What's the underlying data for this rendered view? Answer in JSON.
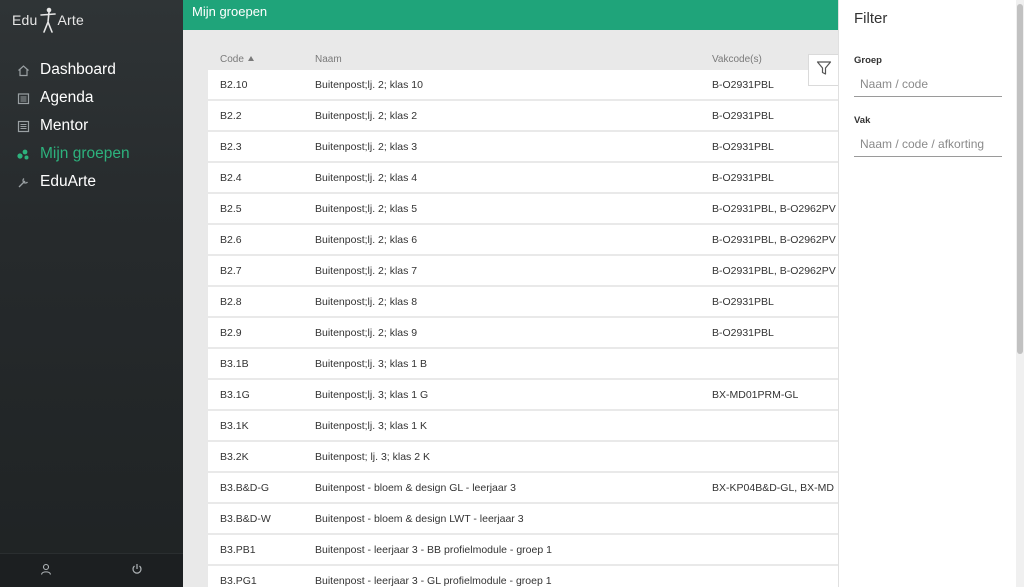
{
  "app": {
    "logo_left": "Edu",
    "logo_right": "Arte"
  },
  "sidebar": {
    "items": [
      {
        "label": "Dashboard",
        "icon": "home-icon"
      },
      {
        "label": "Agenda",
        "icon": "calendar-icon"
      },
      {
        "label": "Mentor",
        "icon": "list-icon"
      },
      {
        "label": "Mijn groepen",
        "icon": "groups-icon",
        "active": true
      },
      {
        "label": "EduArte",
        "icon": "tools-icon"
      }
    ],
    "bottom": [
      {
        "icon": "user-icon"
      },
      {
        "icon": "power-icon"
      }
    ]
  },
  "header": {
    "title": "Mijn groepen"
  },
  "table": {
    "columns": {
      "code": "Code",
      "naam": "Naam",
      "vakcodes": "Vakcode(s)"
    },
    "sort": {
      "column": "code",
      "direction": "ascending"
    },
    "rows": [
      {
        "code": "B2.10",
        "naam": "Buitenpost;lj. 2; klas 10",
        "vakcodes": "B-O2931PBL"
      },
      {
        "code": "B2.2",
        "naam": "Buitenpost;lj. 2; klas 2",
        "vakcodes": "B-O2931PBL"
      },
      {
        "code": "B2.3",
        "naam": "Buitenpost;lj. 2; klas 3",
        "vakcodes": "B-O2931PBL"
      },
      {
        "code": "B2.4",
        "naam": "Buitenpost;lj. 2; klas 4",
        "vakcodes": "B-O2931PBL"
      },
      {
        "code": "B2.5",
        "naam": "Buitenpost;lj. 2; klas 5",
        "vakcodes": "B-O2931PBL, B-O2962PV"
      },
      {
        "code": "B2.6",
        "naam": "Buitenpost;lj. 2; klas 6",
        "vakcodes": "B-O2931PBL, B-O2962PV"
      },
      {
        "code": "B2.7",
        "naam": "Buitenpost;lj. 2; klas 7",
        "vakcodes": "B-O2931PBL, B-O2962PV"
      },
      {
        "code": "B2.8",
        "naam": "Buitenpost;lj. 2; klas 8",
        "vakcodes": "B-O2931PBL"
      },
      {
        "code": "B2.9",
        "naam": "Buitenpost;lj. 2; klas 9",
        "vakcodes": "B-O2931PBL"
      },
      {
        "code": "B3.1B",
        "naam": "Buitenpost;lj. 3; klas 1 B",
        "vakcodes": ""
      },
      {
        "code": "B3.1G",
        "naam": "Buitenpost;lj. 3; klas 1 G",
        "vakcodes": "BX-MD01PRM-GL"
      },
      {
        "code": "B3.1K",
        "naam": "Buitenpost;lj. 3; klas 1 K",
        "vakcodes": ""
      },
      {
        "code": "B3.2K",
        "naam": "Buitenpost; lj. 3; klas 2 K",
        "vakcodes": ""
      },
      {
        "code": "B3.B&D-G",
        "naam": "Buitenpost - bloem & design GL - leerjaar 3",
        "vakcodes": "BX-KP04B&D-GL, BX-MD"
      },
      {
        "code": "B3.B&D-W",
        "naam": "Buitenpost - bloem & design LWT - leerjaar 3",
        "vakcodes": ""
      },
      {
        "code": "B3.PB1",
        "naam": "Buitenpost - leerjaar 3 - BB profielmodule - groep 1",
        "vakcodes": ""
      },
      {
        "code": "B3.PG1",
        "naam": "Buitenpost - leerjaar 3 - GL profielmodule - groep 1",
        "vakcodes": ""
      }
    ]
  },
  "filter": {
    "title": "Filter",
    "groep_label": "Groep",
    "groep_placeholder": "Naam / code",
    "groep_value": "",
    "vak_label": "Vak",
    "vak_placeholder": "Naam / code / afkorting",
    "vak_value": ""
  },
  "colors": {
    "accent": "#1fa47a",
    "active_nav": "#2db27d",
    "sidebar_bg": "#2b2f31"
  }
}
